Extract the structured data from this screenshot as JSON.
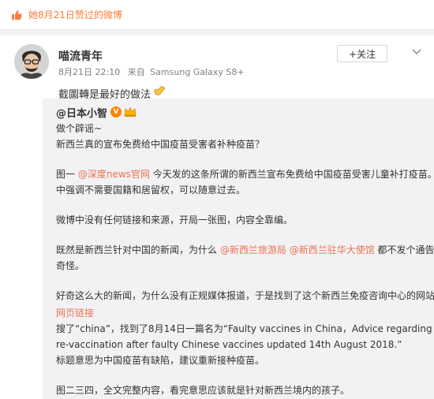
{
  "header": {
    "liked_text": "她8月21日赞过的微博"
  },
  "post": {
    "author": "喵流青年",
    "time": "8月21日 22:10",
    "source_prefix": "来自",
    "source": "Samsung Galaxy S8+",
    "follow_label": "+关注",
    "text": "截圖轉是最好的做法"
  },
  "repost": {
    "author": "@日本小智",
    "badge_v": "V",
    "lines": [
      "做个辟谣~",
      "新西兰真的宣布免费给中国疫苗受害者补种疫苗？"
    ],
    "p2_a": "图一",
    "p2_mention": "@深度news官网",
    "p2_b": "今天发的这条所谓的新西兰宣布免费给中国疫苗受害儿童补打疫苗。文",
    "p2_c": "中强调不需要国籍和居留权，可以随意过去。",
    "p3": "微博中没有任何链接和来源，开局一张图，内容全靠编。",
    "p4_a": "既然是新西兰针对中国的新闻，为什么",
    "p4_m1": "@新西兰旅游局",
    "p4_m2": "@新西兰驻华大使馆",
    "p4_b": "都不发个通告？很",
    "p4_c": "奇怪。",
    "p5_a": "好奇这么大的新闻，为什么没有正规媒体报道，于是找到了这个新西兰免疫咨询中心的网站",
    "p5_link": "网页链接",
    "p5_b": "搜了“china”，找到了8月14日一篇名为“Faulty vaccines in China，Advice regarding",
    "p5_c": "re-vaccination after faulty Chinese vaccines updated 14th August 2018.”",
    "p5_d": "标题意思为中国疫苗有缺陷，建议重新接种疫苗。",
    "p6": "图二三四，全文完整内容，看完意思应该就是针对新西兰境内的孩子。"
  },
  "colors": {
    "accent": "#eb7350",
    "brand_orange": "#ff8200",
    "liked_text": "#fa7d3c"
  },
  "icons": [
    "thumbs-up-icon",
    "chevron-down-icon",
    "verified-v-icon",
    "crown-badge-icon",
    "clapping-hands-emoji-icon",
    "link-icon"
  ]
}
